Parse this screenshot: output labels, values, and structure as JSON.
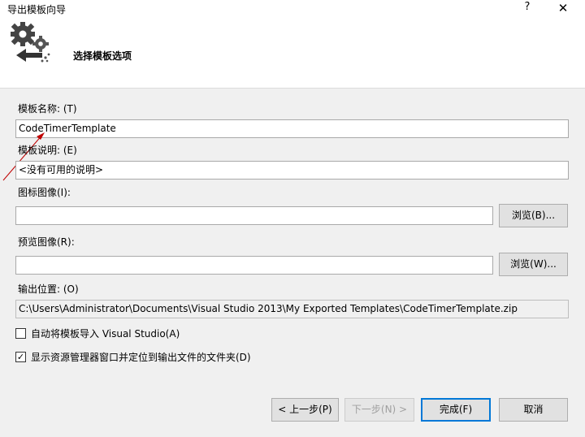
{
  "window": {
    "title": "导出模板向导",
    "help_label": "?",
    "close_label": "✕"
  },
  "header": {
    "subtitle": "选择模板选项",
    "icon": "gears-arrow-icon"
  },
  "form": {
    "template_name": {
      "label": "模板名称: (T)",
      "value": "CodeTimerTemplate"
    },
    "template_description": {
      "label": "模板说明: (E)",
      "value": "<没有可用的说明>"
    },
    "icon_image": {
      "label": "图标图像(I):",
      "value": "",
      "browse_label": "浏览(B)..."
    },
    "preview_image": {
      "label": "预览图像(R):",
      "value": "",
      "browse_label": "浏览(W)..."
    },
    "output_location": {
      "label": "输出位置: (O)",
      "value": "C:\\Users\\Administrator\\Documents\\Visual Studio 2013\\My Exported Templates\\CodeTimerTemplate.zip"
    },
    "auto_import": {
      "label": "自动将模板导入 Visual Studio(A)",
      "checked": false
    },
    "show_explorer": {
      "label": "显示资源管理器窗口并定位到输出文件的文件夹(D)",
      "checked": true
    }
  },
  "buttons": {
    "prev": "< 上一步(P)",
    "next": "下一步(N) >",
    "finish": "完成(F)",
    "cancel": "取消"
  },
  "colors": {
    "accent": "#0078d7",
    "annotation_arrow": "#c00000"
  }
}
